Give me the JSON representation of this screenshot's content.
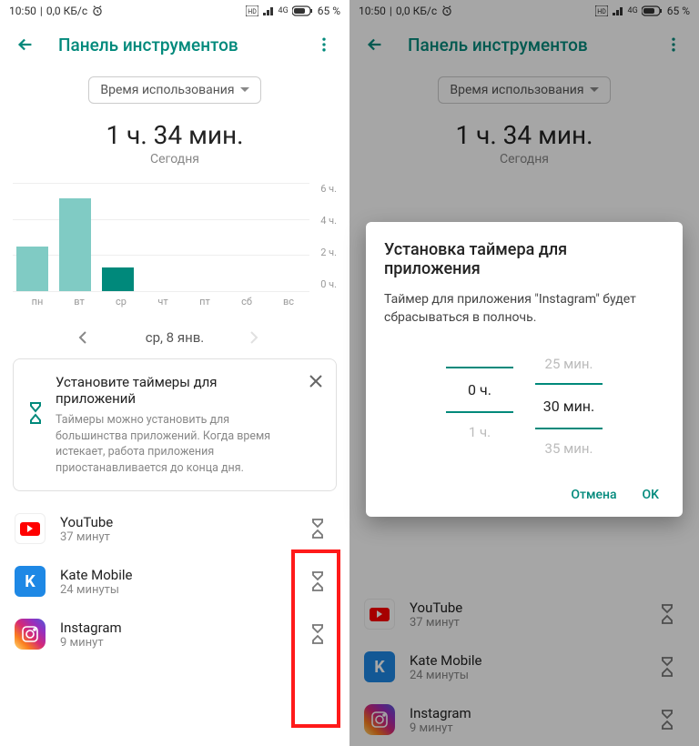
{
  "status": {
    "time": "10:50",
    "net": "0,0 КБ/с",
    "battery": "65 %",
    "net_label": "4G"
  },
  "appbar": {
    "title": "Панель инструментов"
  },
  "filter": {
    "label": "Время использования"
  },
  "summary": {
    "big": "1 ч. 34 мин.",
    "sub": "Сегодня"
  },
  "chart_data": {
    "type": "bar",
    "categories": [
      "пн",
      "вт",
      "ср",
      "чт",
      "пт",
      "сб",
      "вс"
    ],
    "values": [
      2.5,
      5.2,
      1.3,
      0,
      0,
      0,
      0
    ],
    "ylabel": "",
    "ylim": [
      0,
      6
    ],
    "yticks": [
      "6 ч.",
      "4 ч.",
      "2 ч.",
      "0 ч."
    ],
    "highlight_index": 2
  },
  "date_nav": {
    "label": "ср, 8 янв."
  },
  "tip": {
    "title": "Установите таймеры для приложений",
    "body": "Таймеры можно установить для большинства приложений. Когда время истекает, работа приложения приостанавливается до конца дня."
  },
  "apps": [
    {
      "name": "YouTube",
      "time": "37 минут",
      "icon": "yt"
    },
    {
      "name": "Kate Mobile",
      "time": "24 минуты",
      "icon": "kate"
    },
    {
      "name": "Instagram",
      "time": "9 минут",
      "icon": "insta"
    }
  ],
  "dialog": {
    "title": "Установка таймера для приложения",
    "body": "Таймер для приложения \"Instagram\" будет сбрасываться в полночь.",
    "picker": {
      "hours_prev": "",
      "hours": "0 ч.",
      "hours_next": "1 ч.",
      "mins_prev": "25 мин.",
      "mins": "30 мин.",
      "mins_next": "35 мин."
    },
    "cancel": "Отмена",
    "ok": "OK"
  }
}
